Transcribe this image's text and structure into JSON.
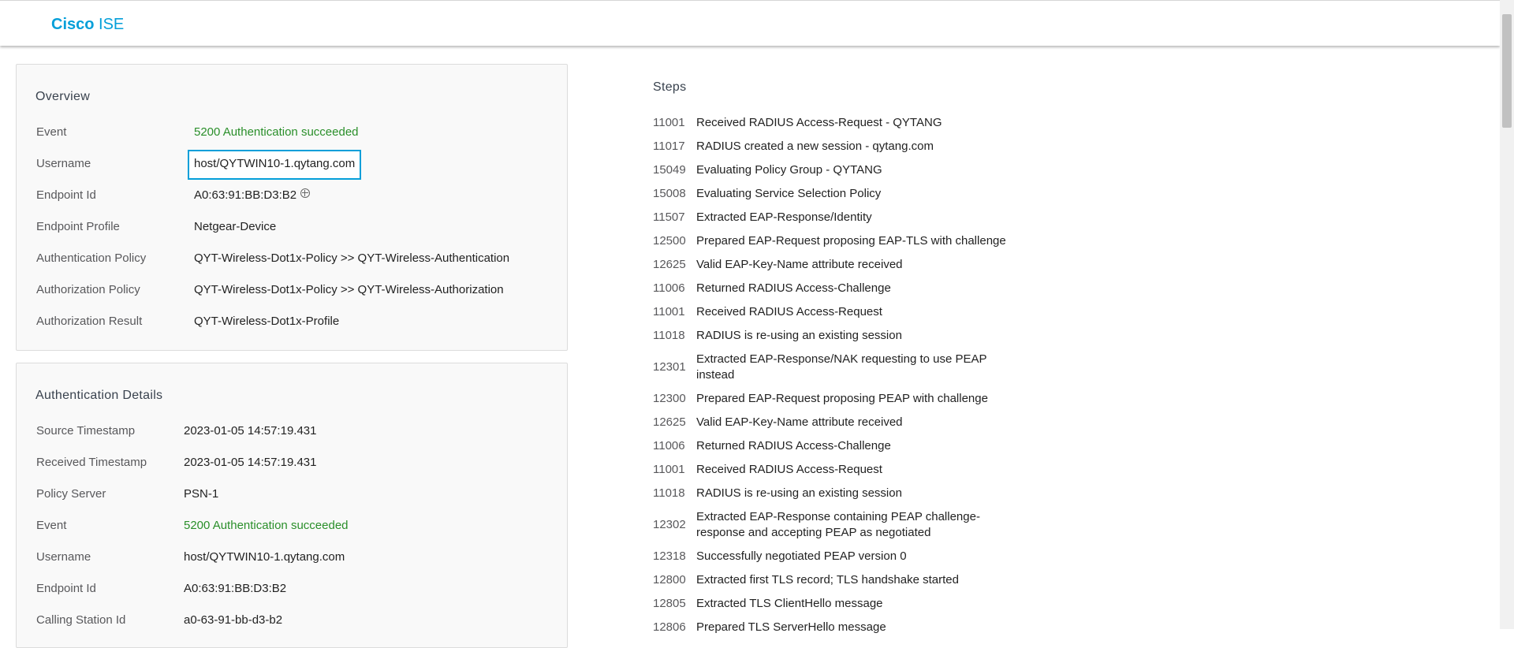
{
  "app": {
    "brand_bold": "Cisco",
    "brand_light": "ISE"
  },
  "overview": {
    "title": "Overview",
    "rows": [
      {
        "label": "Event",
        "value": "5200 Authentication succeeded"
      },
      {
        "label": "Username",
        "value": "host/QYTWIN10-1.qytang.com"
      },
      {
        "label": "Endpoint Id",
        "value": "A0:63:91:BB:D3:B2"
      },
      {
        "label": "Endpoint Profile",
        "value": "Netgear-Device"
      },
      {
        "label": "Authentication Policy",
        "value": "QYT-Wireless-Dot1x-Policy >> QYT-Wireless-Authentication"
      },
      {
        "label": "Authorization Policy",
        "value": "QYT-Wireless-Dot1x-Policy >> QYT-Wireless-Authorization"
      },
      {
        "label": "Authorization Result",
        "value": "QYT-Wireless-Dot1x-Profile"
      }
    ]
  },
  "auth_details": {
    "title": "Authentication Details",
    "rows": [
      {
        "label": "Source Timestamp",
        "value": "2023-01-05 14:57:19.431"
      },
      {
        "label": "Received Timestamp",
        "value": "2023-01-05 14:57:19.431"
      },
      {
        "label": "Policy Server",
        "value": "PSN-1"
      },
      {
        "label": "Event",
        "value": "5200 Authentication succeeded"
      },
      {
        "label": "Username",
        "value": "host/QYTWIN10-1.qytang.com"
      },
      {
        "label": "Endpoint Id",
        "value": "A0:63:91:BB:D3:B2"
      },
      {
        "label": "Calling Station Id",
        "value": "a0-63-91-bb-d3-b2"
      }
    ]
  },
  "steps": {
    "title": "Steps",
    "items": [
      {
        "code": "11001",
        "desc": "Received RADIUS Access-Request - QYTANG"
      },
      {
        "code": "11017",
        "desc": "RADIUS created a new session - qytang.com"
      },
      {
        "code": "15049",
        "desc": "Evaluating Policy Group - QYTANG"
      },
      {
        "code": "15008",
        "desc": "Evaluating Service Selection Policy"
      },
      {
        "code": "11507",
        "desc": "Extracted EAP-Response/Identity"
      },
      {
        "code": "12500",
        "desc": "Prepared EAP-Request proposing EAP-TLS with challenge"
      },
      {
        "code": "12625",
        "desc": "Valid EAP-Key-Name attribute received"
      },
      {
        "code": "11006",
        "desc": "Returned RADIUS Access-Challenge"
      },
      {
        "code": "11001",
        "desc": "Received RADIUS Access-Request"
      },
      {
        "code": "11018",
        "desc": "RADIUS is re-using an existing session"
      },
      {
        "code": "12301",
        "desc": "Extracted EAP-Response/NAK requesting to use PEAP instead"
      },
      {
        "code": "12300",
        "desc": "Prepared EAP-Request proposing PEAP with challenge"
      },
      {
        "code": "12625",
        "desc": "Valid EAP-Key-Name attribute received"
      },
      {
        "code": "11006",
        "desc": "Returned RADIUS Access-Challenge"
      },
      {
        "code": "11001",
        "desc": "Received RADIUS Access-Request"
      },
      {
        "code": "11018",
        "desc": "RADIUS is re-using an existing session"
      },
      {
        "code": "12302",
        "desc": "Extracted EAP-Response containing PEAP challenge-response and accepting PEAP as negotiated"
      },
      {
        "code": "12318",
        "desc": "Successfully negotiated PEAP version 0"
      },
      {
        "code": "12800",
        "desc": "Extracted first TLS record; TLS handshake started"
      },
      {
        "code": "12805",
        "desc": "Extracted TLS ClientHello message"
      },
      {
        "code": "12806",
        "desc": "Prepared TLS ServerHello message"
      }
    ]
  },
  "colors": {
    "brand": "#049fd9",
    "success": "#2a8f2a",
    "highlight": "#049fd9"
  },
  "icons": {
    "endpoint_target": "crosshair-icon"
  }
}
